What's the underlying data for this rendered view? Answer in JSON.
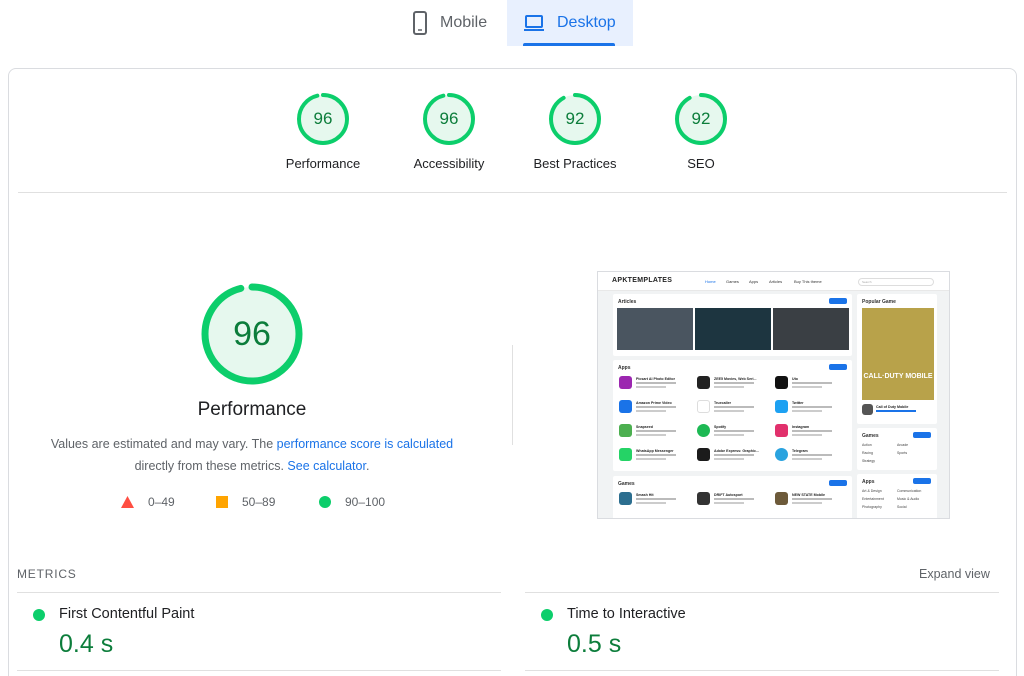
{
  "tabs": [
    {
      "label": "Mobile",
      "icon": "smartphone-icon",
      "active": false
    },
    {
      "label": "Desktop",
      "icon": "laptop-icon",
      "active": true
    }
  ],
  "colors": {
    "pass": "#0cce6b",
    "pass_text": "#0c7d3b",
    "average": "#ffa400",
    "fail": "#ff4e42",
    "accent": "#1a73e8"
  },
  "categories": [
    {
      "label": "Performance",
      "score": "96"
    },
    {
      "label": "Accessibility",
      "score": "96"
    },
    {
      "label": "Best Practices",
      "score": "92"
    },
    {
      "label": "SEO",
      "score": "92"
    }
  ],
  "performance": {
    "score": "96",
    "label": "Performance",
    "desc_part1": "Values are estimated and may vary. The ",
    "desc_link1": "performance score is calculated",
    "desc_part2": " directly from these metrics. ",
    "desc_link2": "See calculator",
    "desc_end": "."
  },
  "legend": [
    {
      "range": "0–49",
      "shape": "triangle"
    },
    {
      "range": "50–89",
      "shape": "square"
    },
    {
      "range": "90–100",
      "shape": "circle"
    }
  ],
  "screenshot": {
    "brand": "APKTEMPLATES",
    "nav": [
      "Home",
      "Games",
      "Apps",
      "Articles",
      "Buy This theme"
    ],
    "search_placeholder": "Search",
    "articles_title": "Articles",
    "popular_title": "Popular Game",
    "apps_title": "Apps",
    "games_title": "Games",
    "game_art_text": "CALL·DUTY MOBILE",
    "popular_game": "Call of Duty Mobile",
    "apps": [
      "Picsart AI Photo Editor",
      "ZEE5 Movies, Web Seri...",
      "Uto",
      "Amazon Prime Video",
      "Truecaller",
      "Twitter",
      "Snapseed",
      "Spotify",
      "Instagram",
      "WhatsApp Messenger",
      "Adobe Express: Graphic...",
      "Telegram"
    ],
    "games": [
      "Smash Hit",
      "DRIFT Autosport",
      "NEW STATE Mobile"
    ],
    "side_games": [
      "Action",
      "Arcade",
      "Racing",
      "Sports",
      "Strategy"
    ],
    "side_apps": [
      "Art & Design",
      "Communication",
      "Entertainment",
      "Music & Audio",
      "Photography",
      "Social"
    ]
  },
  "metrics": {
    "title": "METRICS",
    "expand_label": "Expand view",
    "items": [
      {
        "name": "First Contentful Paint",
        "value": "0.4 s"
      },
      {
        "name": "Time to Interactive",
        "value": "0.5 s"
      }
    ]
  }
}
